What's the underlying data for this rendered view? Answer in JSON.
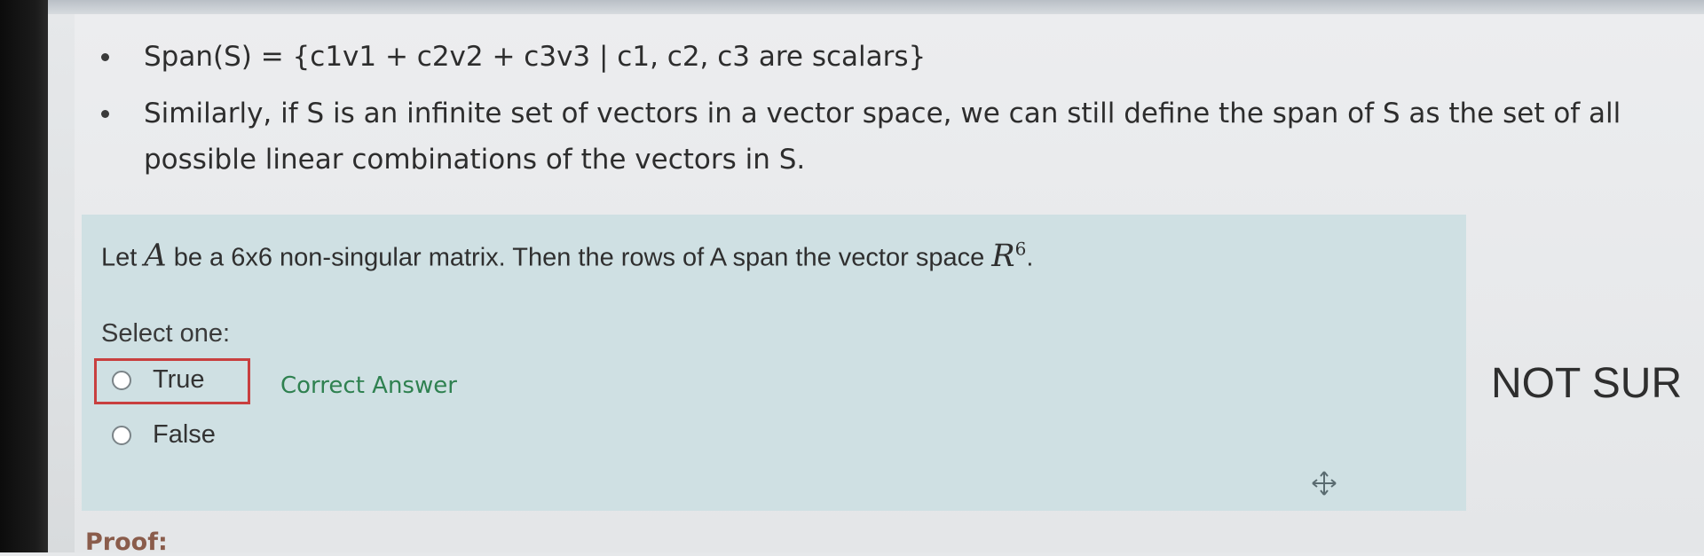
{
  "content": {
    "bullets": [
      "Span(S) = {c1v1 + c2v2 + c3v3 | c1, c2, c3 are scalars}",
      "Similarly, if S is an infinite set of vectors in a vector space, we can still define the span of S as the set of all possible linear combinations of the vectors in S."
    ],
    "question": {
      "prefix": "Let",
      "symbol": "A",
      "middle": "be a 6x6 non-singular matrix. Then the rows of A span the vector space",
      "space_symbol": "R",
      "space_exponent": "6",
      "suffix": "."
    },
    "select_prompt": "Select one:",
    "options": [
      {
        "label": "True",
        "selected": false
      },
      {
        "label": "False",
        "selected": false
      }
    ],
    "feedback": "Correct Answer",
    "side_note": "NOT SUR",
    "proof_label": "Proof:"
  },
  "colors": {
    "panel_background": "#cfe0e3",
    "highlight_border": "#c83f3f",
    "correct_text": "#2f8150",
    "proof_text": "#8a5c4b"
  },
  "icons": {
    "move_cursor": "move-cursor-icon"
  }
}
